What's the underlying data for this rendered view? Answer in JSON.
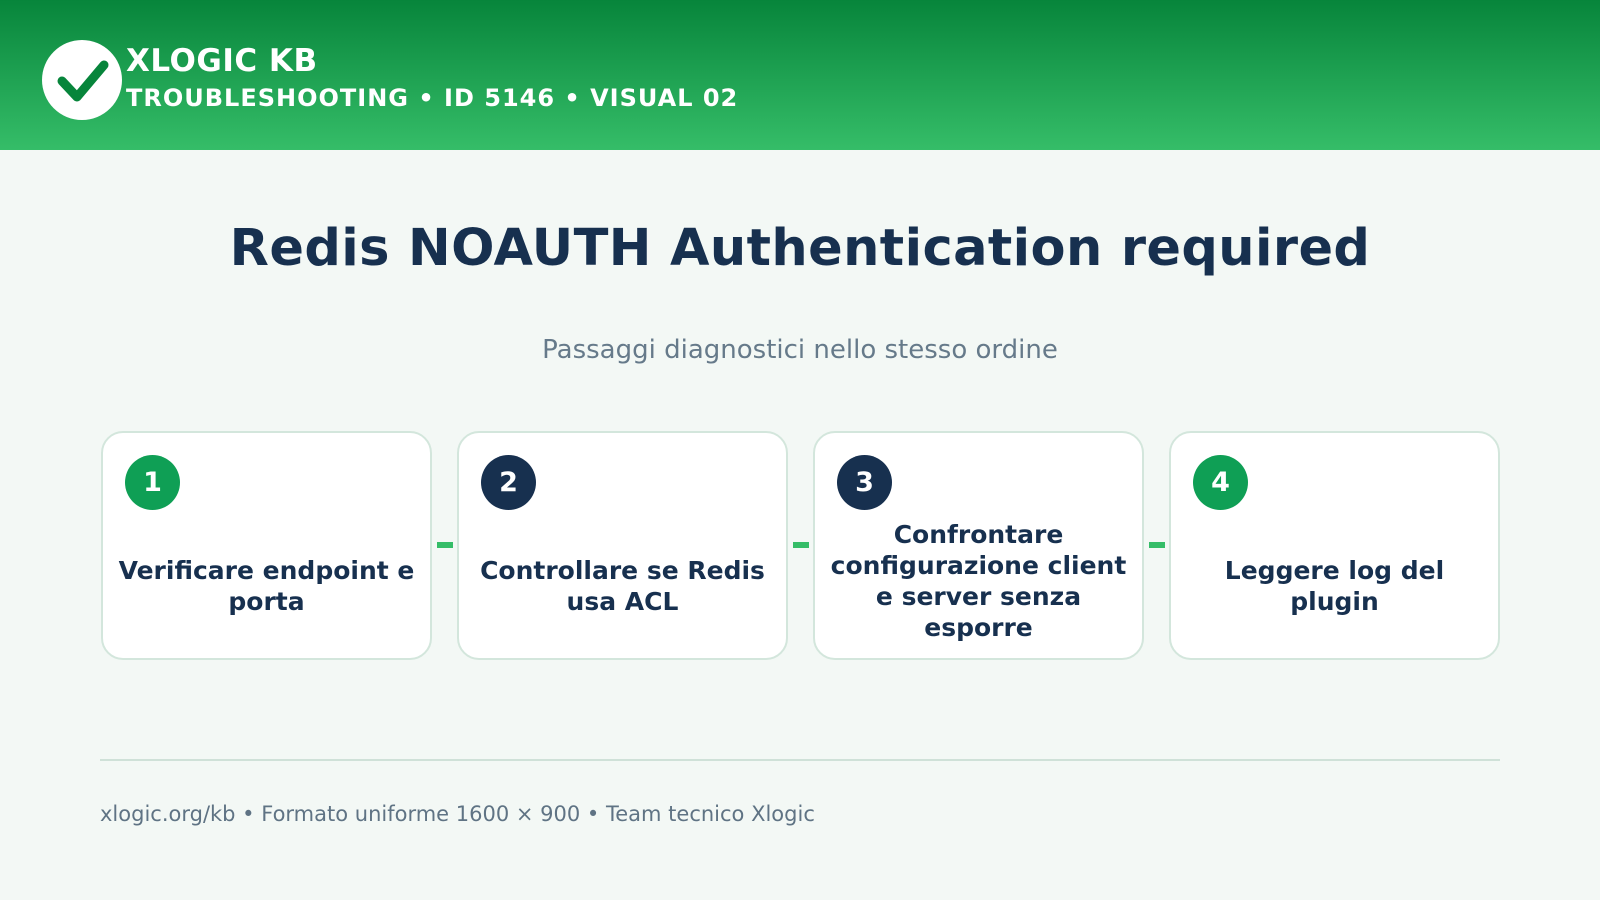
{
  "header": {
    "brand": "XLOGIC KB",
    "breadcrumb": "TROUBLESHOOTING • ID 5146 • VISUAL 02",
    "logo_icon": "check-icon"
  },
  "title": "Redis NOAUTH Authentication required",
  "subtitle": "Passaggi diagnostici nello stesso ordine",
  "steps": [
    {
      "number": "1",
      "text": "Verificare endpoint e porta",
      "badge_color": "#0f9f55"
    },
    {
      "number": "2",
      "text": "Controllare se Redis usa ACL",
      "badge_color": "#17304f"
    },
    {
      "number": "3",
      "text": "Confrontare configurazione client e server senza esporre",
      "badge_color": "#17304f"
    },
    {
      "number": "4",
      "text": "Leggere log del plugin",
      "badge_color": "#0f9f55"
    }
  ],
  "footer": "xlogic.org/kb • Formato uniforme 1600 × 900 • Team tecnico Xlogic",
  "colors": {
    "accent": "#35bd68",
    "brand_green": "#07853b",
    "navy": "#17304f",
    "background": "#f3f8f5"
  }
}
